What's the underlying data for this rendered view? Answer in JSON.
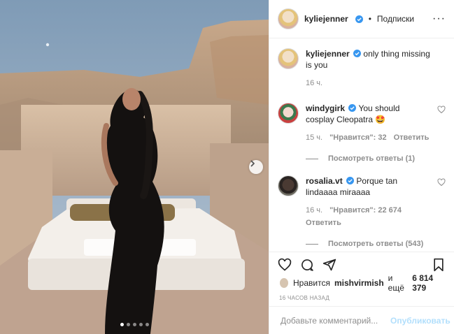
{
  "post": {
    "username": "kyliejenner",
    "follow_separator": "•",
    "follow_label": "Подписки",
    "caption_text": "only thing missing is you",
    "caption_time": "16 ч."
  },
  "comments": [
    {
      "username": "windygirk",
      "text": "You should cosplay Cleopatra 🤩",
      "time": "15 ч.",
      "likes": "\"Нравится\": 32",
      "reply_label": "Ответить",
      "view_replies": "Посмотреть ответы (1)"
    },
    {
      "username": "rosalia.vt",
      "text": "Porque tan lindaaaa miraaaa",
      "time": "16 ч.",
      "likes": "\"Нравится\": 22 674",
      "reply_label": "Ответить",
      "view_replies": "Посмотреть ответы (543)"
    }
  ],
  "likes_line": {
    "prefix": "Нравится",
    "user": "mishvirmish",
    "middle": "и ещё",
    "count": "6 814 379"
  },
  "timestamp": "16 ЧАСОВ НАЗАД",
  "comment_box": {
    "placeholder": "Добавьте комментарий...",
    "post_label": "Опубликовать"
  },
  "carousel": {
    "count": 5,
    "active": 0
  },
  "colors": {
    "verified": "#3897f0",
    "link_disabled": "#b2dffc",
    "muted": "#8e8e8e"
  },
  "icons": [
    "heart-icon",
    "comment-icon",
    "share-icon",
    "bookmark-icon",
    "chevron-right-icon",
    "more-icon",
    "verified-icon"
  ]
}
